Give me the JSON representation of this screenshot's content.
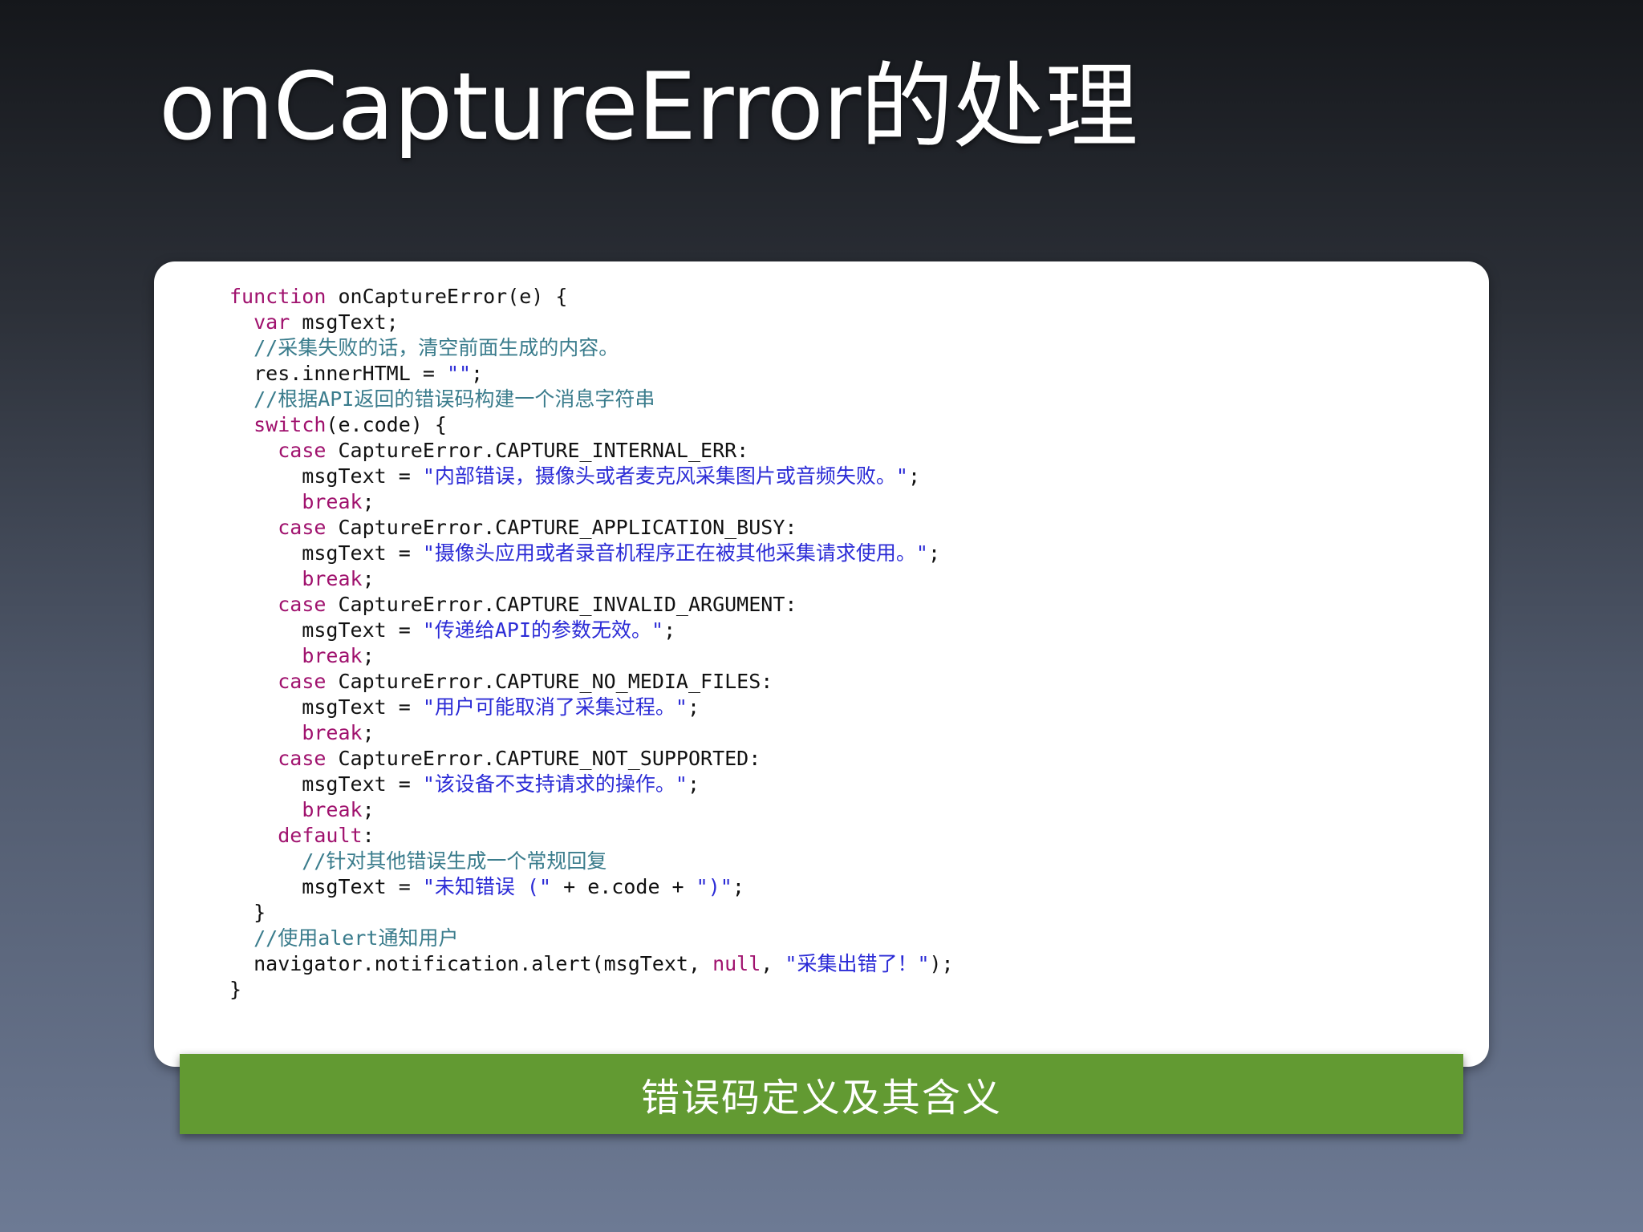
{
  "slide": {
    "title": "onCaptureError的处理",
    "caption": "错误码定义及其含义"
  },
  "colors": {
    "keyword": "#a0126e",
    "comment": "#3a7c8c",
    "string": "#2b2bd6",
    "text": "#111111",
    "caption_bar": "#629a32",
    "card": "#ffffff"
  },
  "code": {
    "lines": [
      [
        {
          "t": "kw",
          "s": "function"
        },
        {
          "t": "txt",
          "s": " onCaptureError(e) {"
        }
      ],
      [
        {
          "t": "txt",
          "s": "  "
        },
        {
          "t": "kw",
          "s": "var"
        },
        {
          "t": "txt",
          "s": " msgText;"
        }
      ],
      [
        {
          "t": "cm",
          "s": "  //采集失败的话，清空前面生成的内容。"
        }
      ],
      [
        {
          "t": "txt",
          "s": "  res.innerHTML = "
        },
        {
          "t": "str",
          "s": "\"\""
        },
        {
          "t": "txt",
          "s": ";"
        }
      ],
      [
        {
          "t": "cm",
          "s": "  //根据API返回的错误码构建一个消息字符串"
        }
      ],
      [
        {
          "t": "txt",
          "s": "  "
        },
        {
          "t": "kw",
          "s": "switch"
        },
        {
          "t": "txt",
          "s": "(e.code) {"
        }
      ],
      [
        {
          "t": "txt",
          "s": "    "
        },
        {
          "t": "kw",
          "s": "case"
        },
        {
          "t": "txt",
          "s": " CaptureError.CAPTURE_INTERNAL_ERR:"
        }
      ],
      [
        {
          "t": "txt",
          "s": "      msgText = "
        },
        {
          "t": "str",
          "s": "\"内部错误，摄像头或者麦克风采集图片或音频失败。\""
        },
        {
          "t": "txt",
          "s": ";"
        }
      ],
      [
        {
          "t": "txt",
          "s": "      "
        },
        {
          "t": "kw",
          "s": "break"
        },
        {
          "t": "txt",
          "s": ";"
        }
      ],
      [
        {
          "t": "txt",
          "s": "    "
        },
        {
          "t": "kw",
          "s": "case"
        },
        {
          "t": "txt",
          "s": " CaptureError.CAPTURE_APPLICATION_BUSY:"
        }
      ],
      [
        {
          "t": "txt",
          "s": "      msgText = "
        },
        {
          "t": "str",
          "s": "\"摄像头应用或者录音机程序正在被其他采集请求使用。\""
        },
        {
          "t": "txt",
          "s": ";"
        }
      ],
      [
        {
          "t": "txt",
          "s": "      "
        },
        {
          "t": "kw",
          "s": "break"
        },
        {
          "t": "txt",
          "s": ";"
        }
      ],
      [
        {
          "t": "txt",
          "s": "    "
        },
        {
          "t": "kw",
          "s": "case"
        },
        {
          "t": "txt",
          "s": " CaptureError.CAPTURE_INVALID_ARGUMENT:"
        }
      ],
      [
        {
          "t": "txt",
          "s": "      msgText = "
        },
        {
          "t": "str",
          "s": "\"传递给API的参数无效。\""
        },
        {
          "t": "txt",
          "s": ";"
        }
      ],
      [
        {
          "t": "txt",
          "s": "      "
        },
        {
          "t": "kw",
          "s": "break"
        },
        {
          "t": "txt",
          "s": ";"
        }
      ],
      [
        {
          "t": "txt",
          "s": "    "
        },
        {
          "t": "kw",
          "s": "case"
        },
        {
          "t": "txt",
          "s": " CaptureError.CAPTURE_NO_MEDIA_FILES:"
        }
      ],
      [
        {
          "t": "txt",
          "s": "      msgText = "
        },
        {
          "t": "str",
          "s": "\"用户可能取消了采集过程。\""
        },
        {
          "t": "txt",
          "s": ";"
        }
      ],
      [
        {
          "t": "txt",
          "s": "      "
        },
        {
          "t": "kw",
          "s": "break"
        },
        {
          "t": "txt",
          "s": ";"
        }
      ],
      [
        {
          "t": "txt",
          "s": "    "
        },
        {
          "t": "kw",
          "s": "case"
        },
        {
          "t": "txt",
          "s": " CaptureError.CAPTURE_NOT_SUPPORTED:"
        }
      ],
      [
        {
          "t": "txt",
          "s": "      msgText = "
        },
        {
          "t": "str",
          "s": "\"该设备不支持请求的操作。\""
        },
        {
          "t": "txt",
          "s": ";"
        }
      ],
      [
        {
          "t": "txt",
          "s": "      "
        },
        {
          "t": "kw",
          "s": "break"
        },
        {
          "t": "txt",
          "s": ";"
        }
      ],
      [
        {
          "t": "txt",
          "s": "    "
        },
        {
          "t": "kw",
          "s": "default"
        },
        {
          "t": "txt",
          "s": ":"
        }
      ],
      [
        {
          "t": "cm",
          "s": "      //针对其他错误生成一个常规回复"
        }
      ],
      [
        {
          "t": "txt",
          "s": "      msgText = "
        },
        {
          "t": "str",
          "s": "\"未知错误 (\""
        },
        {
          "t": "txt",
          "s": " + e.code + "
        },
        {
          "t": "str",
          "s": "\")\""
        },
        {
          "t": "txt",
          "s": ";"
        }
      ],
      [
        {
          "t": "txt",
          "s": "  }"
        }
      ],
      [
        {
          "t": "cm",
          "s": "  //使用alert通知用户"
        }
      ],
      [
        {
          "t": "txt",
          "s": "  navigator.notification.alert(msgText, "
        },
        {
          "t": "kw",
          "s": "null"
        },
        {
          "t": "txt",
          "s": ", "
        },
        {
          "t": "str",
          "s": "\"采集出错了！\""
        },
        {
          "t": "txt",
          "s": ");"
        }
      ],
      [
        {
          "t": "txt",
          "s": "}"
        }
      ]
    ]
  }
}
